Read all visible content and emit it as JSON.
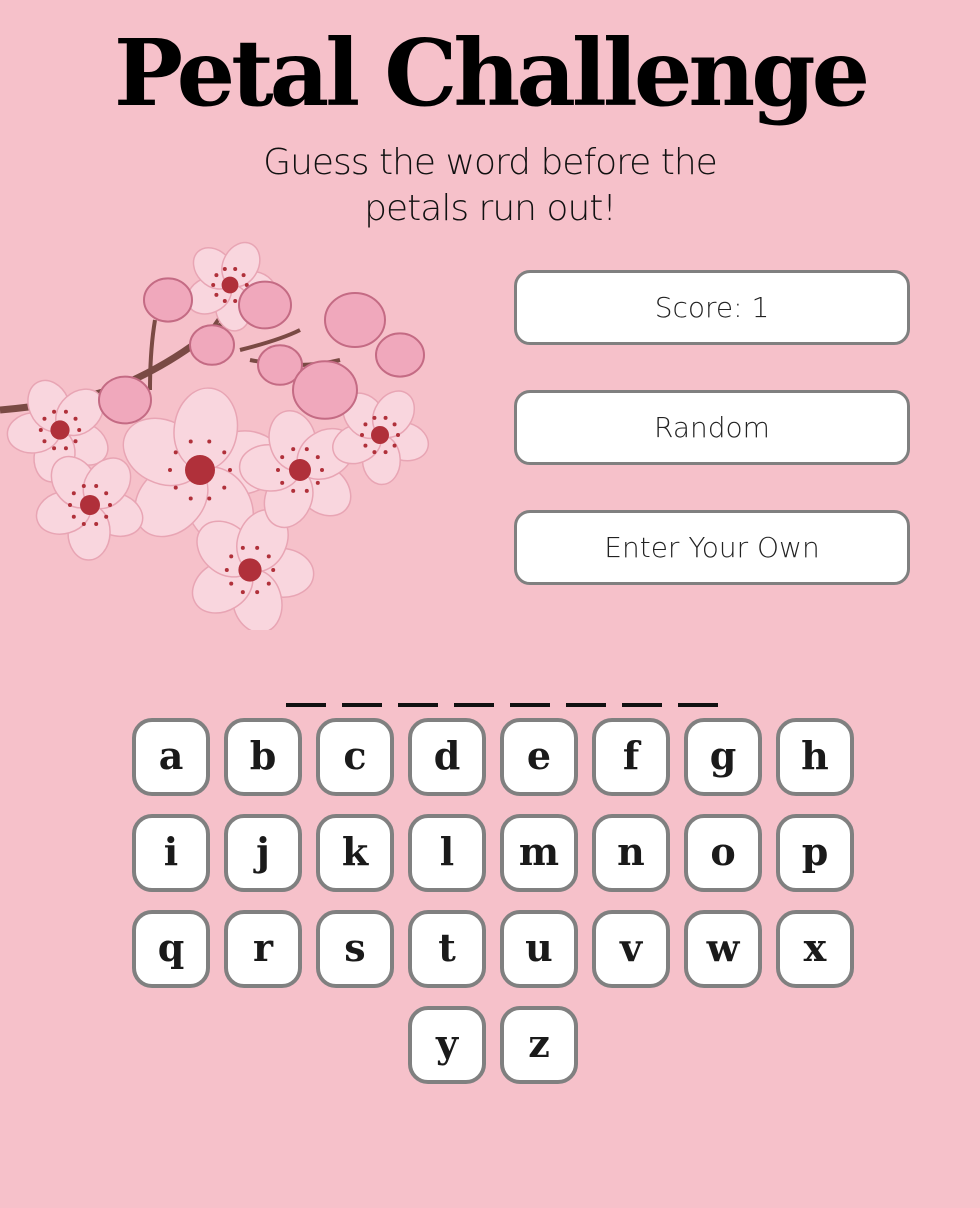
{
  "header": {
    "title": "Petal Challenge",
    "subtitle": "Guess the word before the petals run out!"
  },
  "menu": {
    "score_label": "Score: 1",
    "random_label": "Random",
    "own_label": "Enter Your Own"
  },
  "word": {
    "letter_count": 8
  },
  "keyboard": {
    "rows": [
      [
        "a",
        "b",
        "c",
        "d",
        "e",
        "f",
        "g",
        "h"
      ],
      [
        "i",
        "j",
        "k",
        "l",
        "m",
        "n",
        "o",
        "p"
      ],
      [
        "q",
        "r",
        "s",
        "t",
        "u",
        "v",
        "w",
        "x"
      ],
      [
        "y",
        "z"
      ]
    ]
  },
  "colors": {
    "background": "#f6c1ca",
    "button_fill": "#ffffff",
    "button_border": "#808080",
    "petal": "#f9d6de",
    "petal_dark": "#e8a5b4",
    "stamen": "#b0303a",
    "branch": "#7a4a44"
  }
}
